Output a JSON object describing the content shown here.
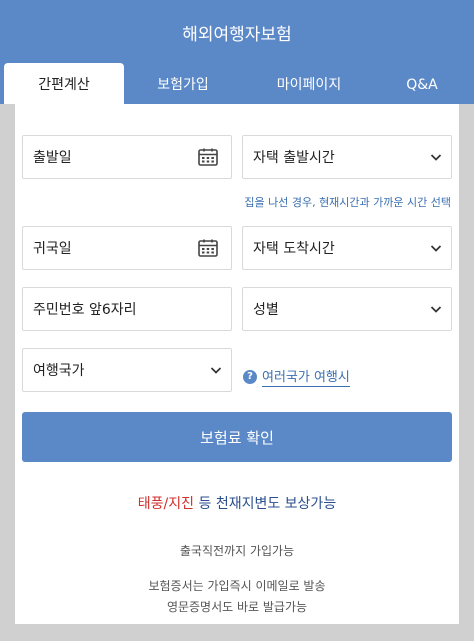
{
  "header": {
    "title": "해외여행자보험"
  },
  "tabs": [
    {
      "label": "간편계산",
      "active": true
    },
    {
      "label": "보험가입",
      "active": false
    },
    {
      "label": "마이페이지",
      "active": false
    },
    {
      "label": "Q&A",
      "active": false
    }
  ],
  "form": {
    "departure_date": {
      "label": "출발일",
      "icon": "calendar-icon"
    },
    "departure_time": {
      "label": "자택 출발시간",
      "icon": "chevron-down-icon"
    },
    "hint": "집을 나선 경우, 현재시간과 가까운 시간 선택",
    "return_date": {
      "label": "귀국일",
      "icon": "calendar-icon"
    },
    "arrival_time": {
      "label": "자택 도착시간",
      "icon": "chevron-down-icon"
    },
    "resident_id": {
      "label": "주민번호 앞6자리"
    },
    "gender": {
      "label": "성별",
      "icon": "chevron-down-icon"
    },
    "country": {
      "label": "여행국가",
      "icon": "chevron-down-icon"
    },
    "multi_country_link": "여러국가 여행시",
    "confirm_button": "보험료 확인"
  },
  "promo": {
    "highlight": "태풍/지진",
    "rest": " 등 천재지변도 보상가능"
  },
  "info": {
    "line1": "출국직전까지 가입가능",
    "line2": "보험증서는 가입즉시 이메일로 발송",
    "line3": "영문증명서도 바로 발급가능"
  },
  "colors": {
    "primary": "#5b89c8",
    "link": "#3a6fb2",
    "highlight_red": "#d0312d"
  }
}
